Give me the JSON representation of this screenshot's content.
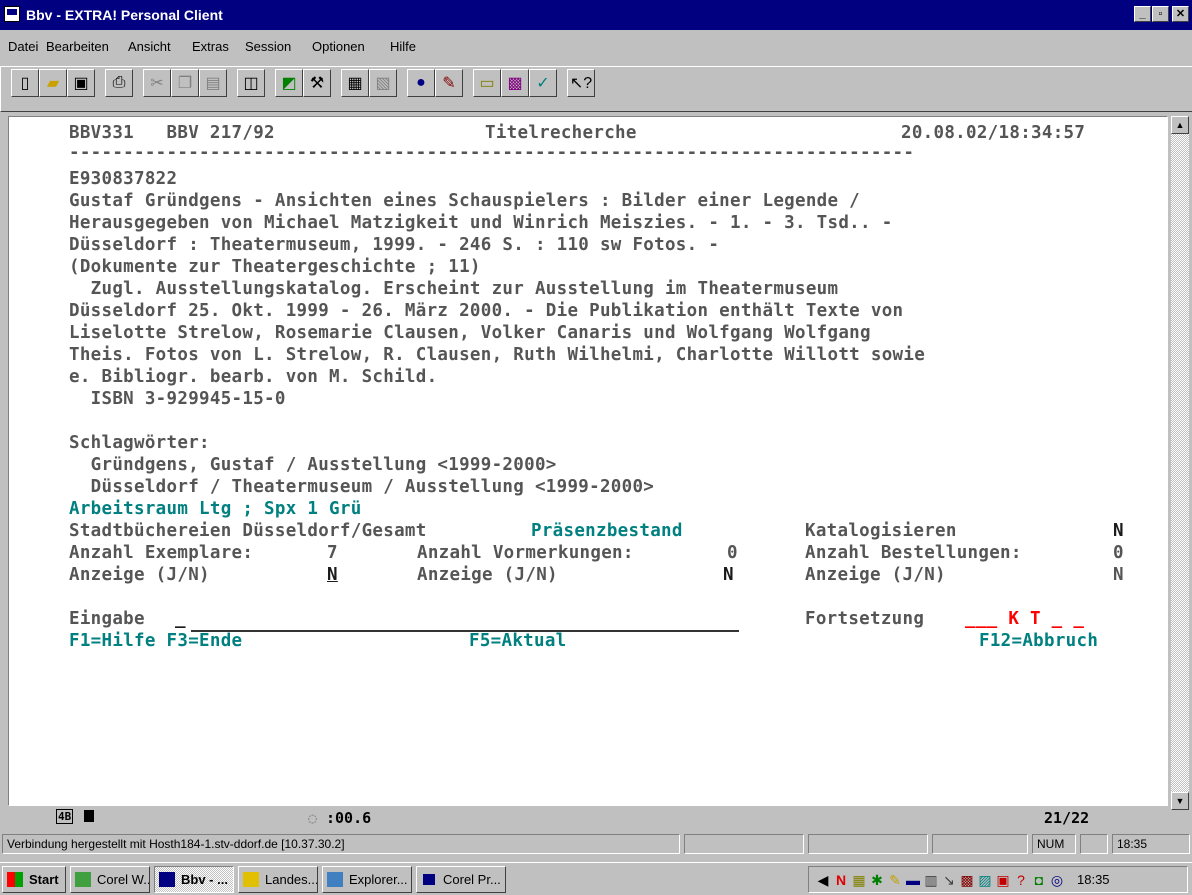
{
  "window": {
    "title": "Bbv - EXTRA! Personal Client"
  },
  "menu": [
    "Datei",
    "Bearbeiten",
    "Ansicht",
    "Extras",
    "Session",
    "Optionen",
    "Hilfe"
  ],
  "toolbar_icons": [
    "new-icon",
    "open-icon",
    "save-icon",
    "print-icon",
    "cut-icon",
    "copy-icon",
    "paste-icon",
    "hotspot-icon",
    "macro-icon",
    "tools-icon",
    "quickpad-icon",
    "transfer-icon",
    "receive-icon",
    "record-icon",
    "play-icon",
    "keyboard-icon",
    "color-icon",
    "font-icon",
    "settings-icon",
    "help-pointer-icon"
  ],
  "terminal": {
    "header_left": "BBV331   BBV 217/92",
    "header_title": "Titelrecherche",
    "header_datetime": "20.08.02/18:34:57",
    "separator": "------------------------------------------------------------------------------",
    "record_id": "E930837822",
    "record_lines": [
      "Gustaf Gründgens - Ansichten eines Schauspielers : Bilder einer Legende /",
      "Herausgegeben von Michael Matzigkeit und Winrich Meiszies. - 1. - 3. Tsd.. -",
      "Düsseldorf : Theatermuseum, 1999. - 246 S. : 110 sw Fotos. -",
      "(Dokumente zur Theatergeschichte ; 11)",
      "  Zugl. Ausstellungskatalog. Erscheint zur Ausstellung im Theatermuseum",
      "Düsseldorf 25. Okt. 1999 - 26. März 2000. - Die Publikation enthält Texte von",
      "Liselotte Strelow, Rosemarie Clausen, Volker Canaris und Wolfgang Wolfgang",
      "Theis. Fotos von L. Strelow, R. Clausen, Ruth Wilhelmi, Charlotte Willott sowie",
      "e. Bibliogr. bearb. von M. Schild.",
      "  ISBN 3-929945-15-0"
    ],
    "subjects_label": "Schlagwörter:",
    "subjects": [
      "  Gründgens, Gustaf / Ausstellung <1999-2000>",
      "  Düsseldorf / Theatermuseum / Ausstellung <1999-2000>"
    ],
    "workspace": "Arbeitsraum Ltg ; Spx 1 Grü",
    "library": "Stadtbüchereien Düsseldorf/Gesamt",
    "holding_status": "Präsenzbestand",
    "cataloging_label": "Katalogisieren",
    "cataloging_value": "N",
    "copies_label": "Anzahl Exemplare:",
    "copies_value": "7",
    "reservations_label": "Anzahl Vormerkungen:",
    "reservations_value": "0",
    "orders_label": "Anzahl Bestellungen:",
    "orders_value": "0",
    "display_label": "Anzeige (J/N)",
    "display_copies_value": "N",
    "display_reservations_value": "N",
    "display_orders_value": "N",
    "input_label": "Eingabe",
    "input_value": "_",
    "continuation_label": "Fortsetzung",
    "continuation_value": "___ K T _ _",
    "fkey_help": "F1=Hilfe F3=Ende",
    "fkey_refresh": "F5=Aktual",
    "fkey_cancel": "F12=Abbruch"
  },
  "oia": {
    "session": "4B",
    "timer": ":00.6",
    "cursor_pos": "21/22"
  },
  "statusbar": {
    "message": "Verbindung hergestellt mit Hosth184-1.stv-ddorf.de [10.37.30.2]",
    "num": "NUM",
    "time": "18:35"
  },
  "taskbar": {
    "start": "Start",
    "tasks": [
      "Corel W...",
      "Bbv - ...",
      "Landes...",
      "Explorer...",
      "Corel Pr..."
    ],
    "clock": "18:35"
  }
}
